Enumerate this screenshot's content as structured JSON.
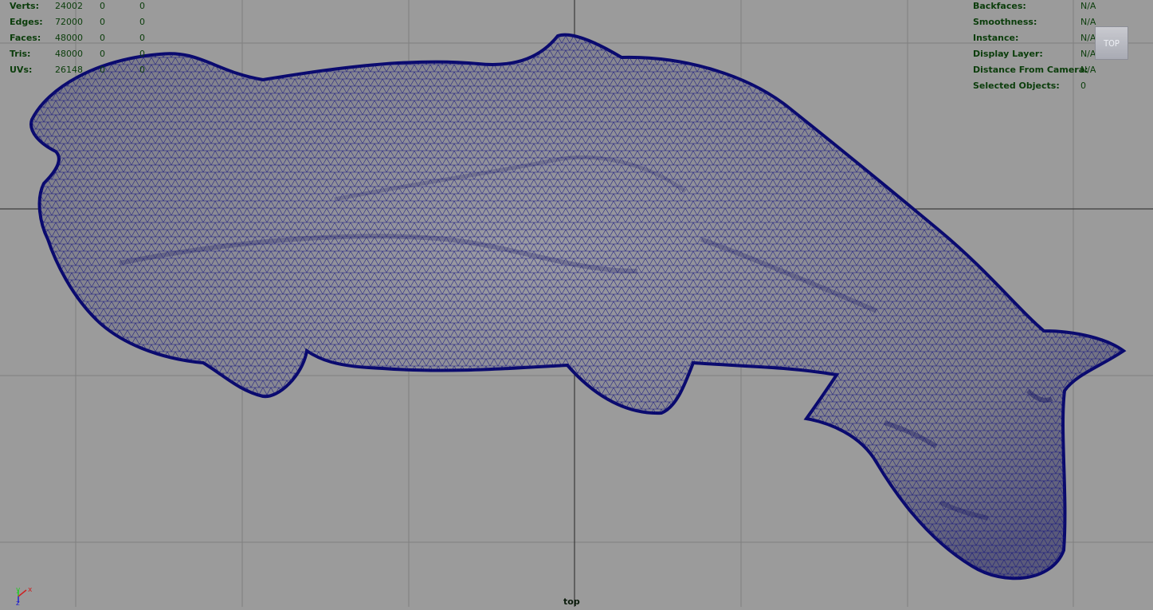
{
  "heads_up_left": [
    {
      "label": "Verts:",
      "value": "24002",
      "selected": "0",
      "components": "0"
    },
    {
      "label": "Edges:",
      "value": "72000",
      "selected": "0",
      "components": "0"
    },
    {
      "label": "Faces:",
      "value": "48000",
      "selected": "0",
      "components": "0"
    },
    {
      "label": "Tris:",
      "value": "48000",
      "selected": "0",
      "components": "0"
    },
    {
      "label": "UVs:",
      "value": "26148",
      "selected": "0",
      "components": "0"
    }
  ],
  "heads_up_right": [
    {
      "label": "Backfaces:",
      "value": "N/A"
    },
    {
      "label": "Smoothness:",
      "value": "N/A"
    },
    {
      "label": "Instance:",
      "value": "N/A"
    },
    {
      "label": "Display Layer:",
      "value": "N/A"
    },
    {
      "label": "Distance From Camera:",
      "value": "N/A"
    },
    {
      "label": "Selected Objects:",
      "value": "0"
    }
  ],
  "view_cube": {
    "label": "TOP"
  },
  "camera_label": "top",
  "axis": {
    "x_label": "x",
    "y_label": "y"
  },
  "colors": {
    "viewport_bg": "#9b9b9b",
    "grid_line": "#7e7e7e",
    "axis_line": "#2a2a2a",
    "mesh_fill": "#8a8a8f",
    "wireframe": "#0a0a78",
    "hud_text": "#0b3d0b"
  }
}
